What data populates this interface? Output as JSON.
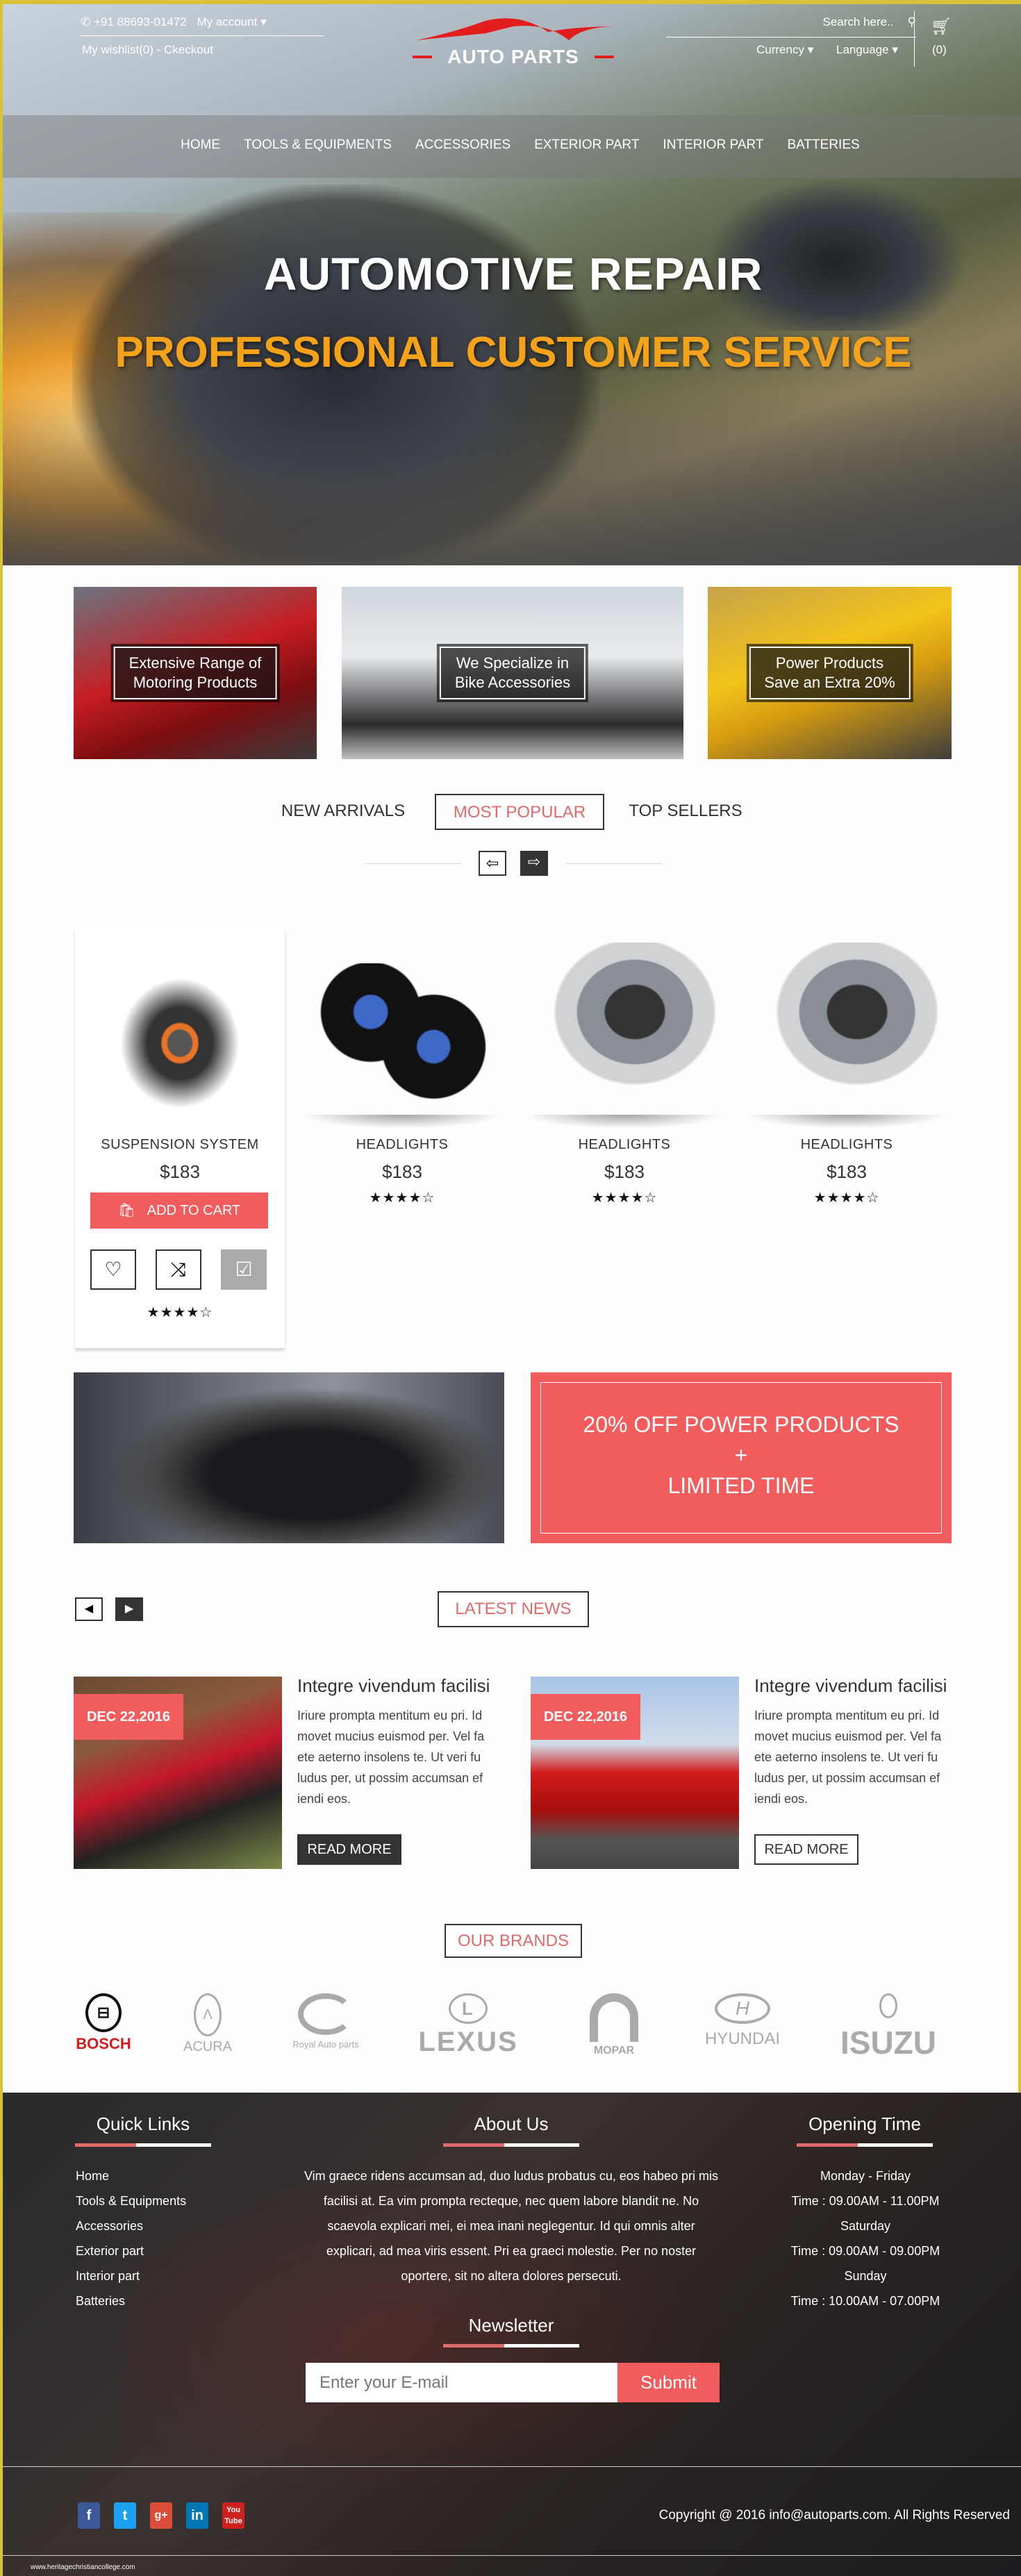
{
  "header": {
    "phone": "+91 88693-01472",
    "my_account": "My account",
    "wishlist_checkout": "My wishlist(0) - Ckeckout",
    "logo_text": "AUTO PARTS",
    "search_placeholder": "Search here..",
    "currency": "Currency",
    "language": "Language",
    "cart_count": "(0)"
  },
  "nav": [
    "HOME",
    "TOOLS & EQUIPMENTS",
    "ACCESSORIES",
    "EXTERIOR PART",
    "INTERIOR PART",
    "BATTERIES"
  ],
  "hero": {
    "title": "AUTOMOTIVE REPAIR",
    "subtitle": "PROFESSIONAL CUSTOMER SERVICE"
  },
  "promos": [
    {
      "line1": "Extensive Range of",
      "line2": "Motoring Products"
    },
    {
      "line1": "We Specialize in",
      "line2": "Bike Accessories"
    },
    {
      "line1": "Power Products",
      "line2": "Save an Extra 20%"
    }
  ],
  "tabs": [
    {
      "label": "NEW ARRIVALS"
    },
    {
      "label": "MOST POPULAR",
      "active": true
    },
    {
      "label": "TOP SELLERS"
    }
  ],
  "products": [
    {
      "name": "SUSPENSION SYSTEM",
      "price": "$183",
      "rating": 4,
      "stars": "★★★★☆"
    },
    {
      "name": "HEADLIGHTS",
      "price": "$183",
      "rating": 4,
      "stars": "★★★★☆"
    },
    {
      "name": "HEADLIGHTS",
      "price": "$183",
      "rating": 4,
      "stars": "★★★★☆"
    },
    {
      "name": "HEADLIGHTS",
      "price": "$183",
      "rating": 4,
      "stars": "★★★★☆"
    }
  ],
  "add_to_cart": "ADD TO CART",
  "offer": {
    "line1": "20% OFF POWER PRODUCTS",
    "line2": "+",
    "line3": "LIMITED TIME"
  },
  "latest_news": "LATEST NEWS",
  "news": [
    {
      "date": "DEC 22,2016",
      "title": "Integre vivendum facilisi",
      "text": "Iriure prompta mentitum eu pri. Id movet mucius euismod per. Vel fa ete aeterno insolens te. Ut veri fu ludus per, ut possim accumsan ef iendi eos.",
      "button": "READ MORE"
    },
    {
      "date": "DEC 22,2016",
      "title": "Integre vivendum facilisi",
      "text": "Iriure prompta mentitum eu pri. Id movet mucius euismod per. Vel fa ete aeterno insolens te. Ut veri fu ludus per, ut possim accumsan ef iendi eos.",
      "button": "READ MORE"
    }
  ],
  "our_brands": "OUR BRANDS",
  "brands": [
    "BOSCH",
    "ACURA",
    "Royal Auto parts",
    "LEXUS",
    "MOPAR",
    "HYUNDAI",
    "ISUZU"
  ],
  "footer": {
    "quick_links_title": "Quick Links",
    "quick_links": [
      "Home",
      "Tools & Equipments",
      "Accessories",
      "Exterior part",
      "Interior part",
      "Batteries"
    ],
    "about_title": "About Us",
    "about_text": "Vim graece ridens accumsan ad, duo ludus probatus cu, eos habeo pri mis facilisi at. Ea vim prompta recteque, nec quem labore blandit ne. No scaevola explicari mei, ei mea inani neglegentur. Id qui omnis alter explicari, ad mea viris essent. Pri ea graeci molestie. Per no noster oportere, sit no altera dolores persecuti.",
    "opening_title": "Opening Time",
    "opening": [
      "Monday - Friday",
      "Time : 09.00AM - 11.00PM",
      "Saturday",
      "Time : 09.00AM - 09.00PM",
      "Sunday",
      "Time : 10.00AM - 07.00PM"
    ],
    "newsletter_title": "Newsletter",
    "email_placeholder": "Enter your E-mail",
    "submit": "Submit",
    "copyright": "Copyright @ 2016 info@autoparts.com. All Rights Reserved",
    "watermark": "www.heritagechristiancollege.com"
  },
  "colors": {
    "accent": "#f25c5c",
    "hero_subtitle": "#f4a21a",
    "border": "#d8c23a"
  }
}
